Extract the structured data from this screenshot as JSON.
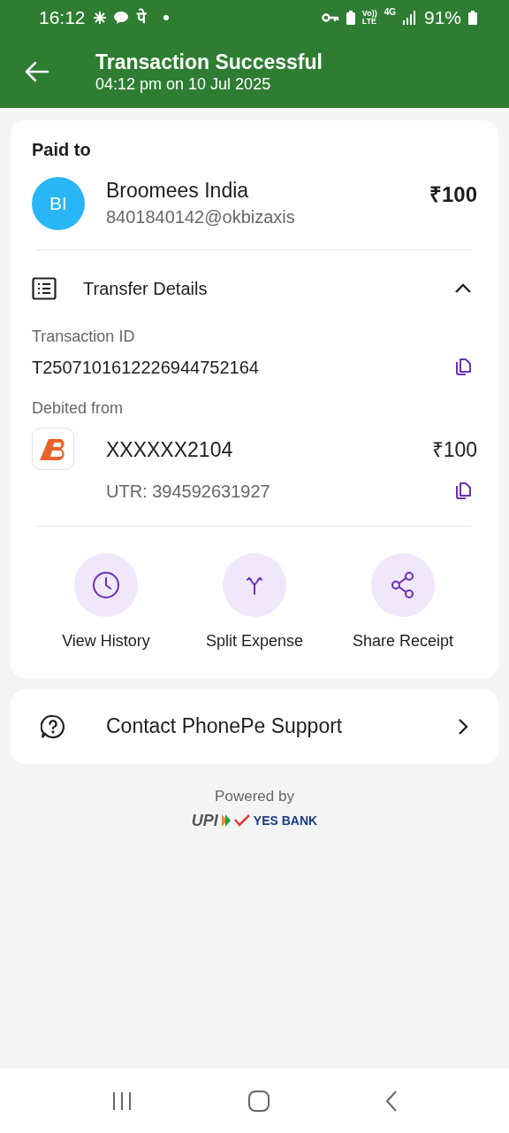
{
  "status_bar": {
    "time": "16:12",
    "app_glyph": "पे",
    "volte": "Vo))",
    "lte": "LTE",
    "network": "4G",
    "battery": "91%"
  },
  "header": {
    "title": "Transaction Successful",
    "subtitle": "04:12 pm on 10 Jul 2025"
  },
  "paid_to": {
    "heading": "Paid to",
    "initials": "BI",
    "name": "Broomees India",
    "upi_id": "8401840142@okbizaxis",
    "amount": "₹100"
  },
  "transfer_details": {
    "title": "Transfer Details",
    "expanded": true,
    "transaction_id_label": "Transaction ID",
    "transaction_id": "T2507101612226944752164",
    "debited_label": "Debited from",
    "account": "XXXXXX2104",
    "amount": "₹100",
    "utr": "UTR: 394592631927"
  },
  "actions": [
    {
      "kind": "history",
      "label": "View History"
    },
    {
      "kind": "split",
      "label": "Split Expense"
    },
    {
      "kind": "share",
      "label": "Share Receipt"
    }
  ],
  "support": {
    "label": "Contact PhonePe Support"
  },
  "footer": {
    "powered_by": "Powered by",
    "upi": "UPI",
    "bank": "YES BANK"
  }
}
